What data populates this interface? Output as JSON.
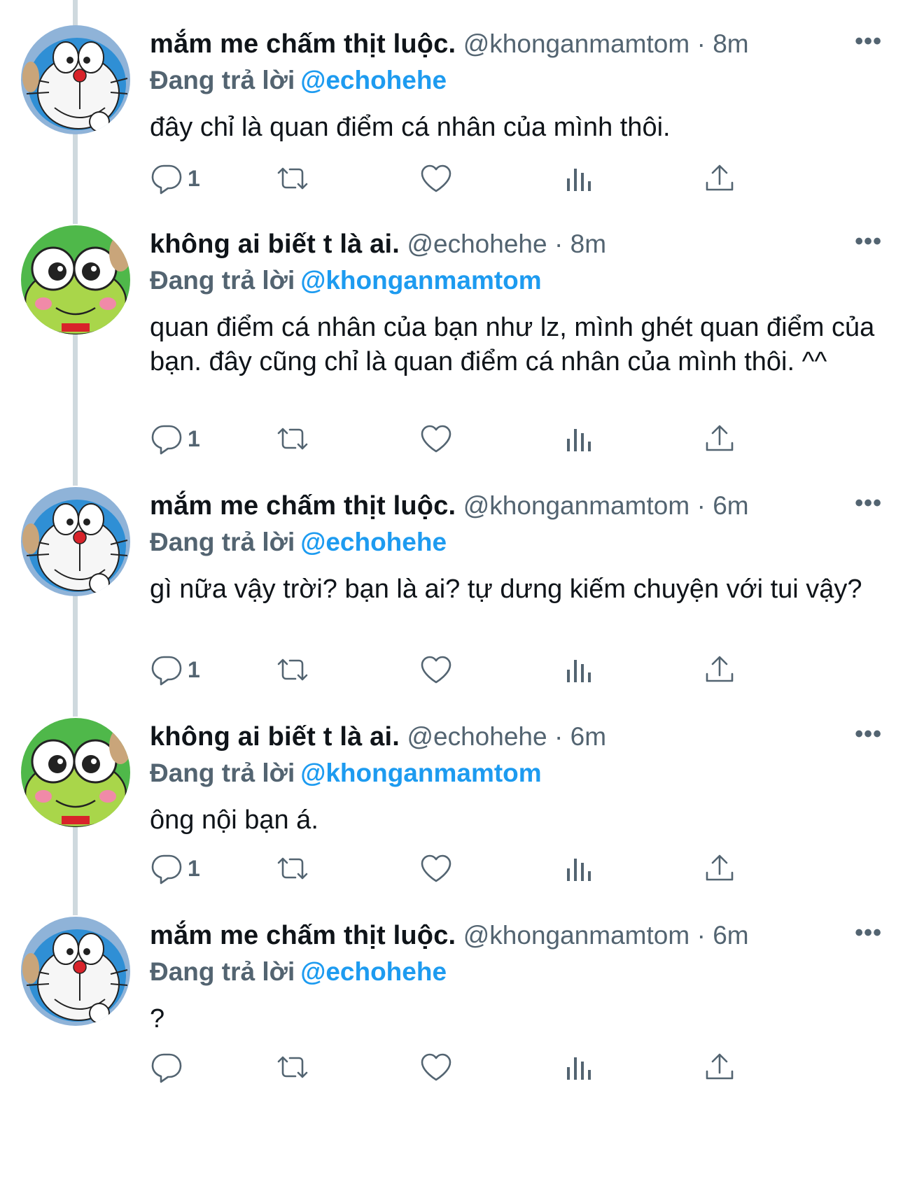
{
  "colors": {
    "text": "#0f1419",
    "muted": "#536471",
    "link": "#1d9bf0",
    "line": "#cfd9de"
  },
  "thread": [
    {
      "avatar_icon": "doraemon-avatar-icon",
      "display_name": "mắm me chấm thịt luộc.",
      "handle": "@khonganmamtom",
      "time": "· 8m",
      "replying_label": "Đang trả lời",
      "replying_to": "@echohehe",
      "text": "đây chỉ là quan điểm cá nhân của mình thôi.",
      "reply_count": "1",
      "more_label": "•••"
    },
    {
      "avatar_icon": "keroppi-avatar-icon",
      "display_name": "không ai biết t là ai.",
      "handle": "@echohehe",
      "time": "· 8m",
      "replying_label": "Đang trả lời",
      "replying_to": "@khonganmamtom",
      "text": "quan điểm cá nhân của bạn như lz, mình ghét quan điểm của bạn. đây cũng chỉ là quan điểm cá nhân của mình thôi. ^^",
      "reply_count": "1",
      "more_label": "•••"
    },
    {
      "avatar_icon": "doraemon-avatar-icon",
      "display_name": "mắm me chấm thịt luộc.",
      "handle": "@khonganmamtom",
      "time": "· 6m",
      "replying_label": "Đang trả lời",
      "replying_to": "@echohehe",
      "text": "gì nữa vậy trời? bạn là ai? tự dưng kiếm chuyện với tui vậy?",
      "reply_count": "1",
      "more_label": "•••"
    },
    {
      "avatar_icon": "keroppi-avatar-icon",
      "display_name": "không ai biết t là ai.",
      "handle": "@echohehe",
      "time": "· 6m",
      "replying_label": "Đang trả lời",
      "replying_to": "@khonganmamtom",
      "text": "ông nội bạn á.",
      "reply_count": "1",
      "more_label": "•••"
    },
    {
      "avatar_icon": "doraemon-avatar-icon",
      "display_name": "mắm me chấm thịt luộc.",
      "handle": "@khonganmamtom",
      "time": "· 6m",
      "replying_label": "Đang trả lời",
      "replying_to": "@echohehe",
      "text": "?",
      "reply_count": "",
      "more_label": "•••"
    }
  ]
}
